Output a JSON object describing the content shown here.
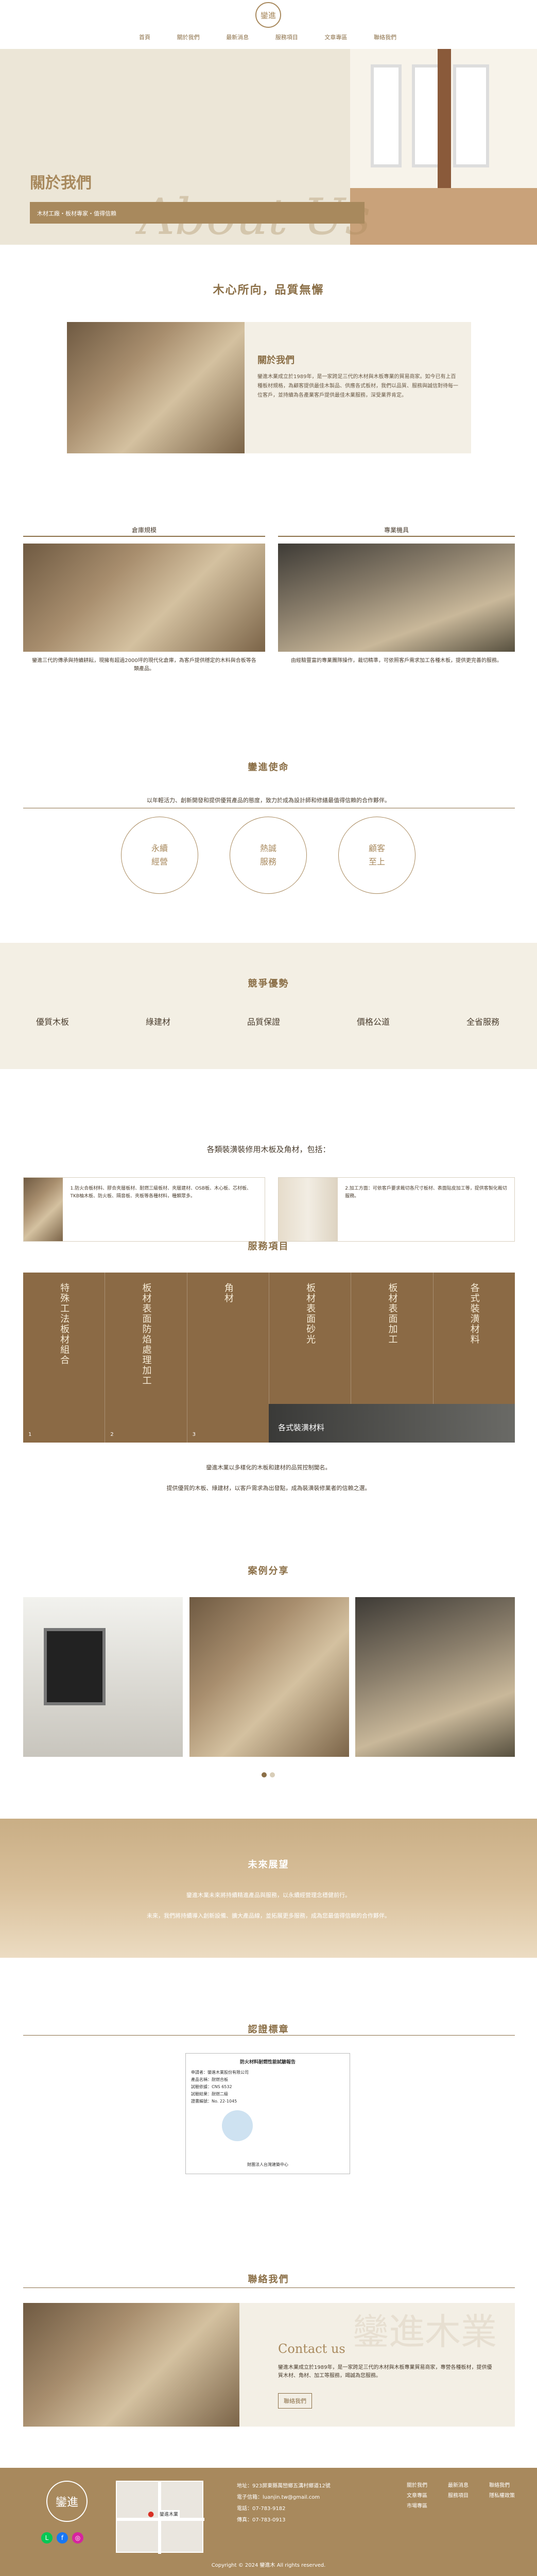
{
  "brand": {
    "name": "鑾進"
  },
  "nav": {
    "items": [
      "首頁",
      "關於我們",
      "最新消息",
      "服務項目",
      "文章專區",
      "聯絡我們"
    ]
  },
  "hero": {
    "script": "About Us",
    "title": "關於我們",
    "subtitle": "木材工廠・板材專家・值得信賴"
  },
  "intro": {
    "title": "木心所向，品質無懈",
    "card_title": "關於我們",
    "card_text": "鑾進木業成立於1989年，是一家跨足三代的木材與木板專業的貿易商家。如今已有上百種板材規格，為顧客提供最佳木製品、供應各式板材，我們以品質、服務與誠信對待每一位客戶，並持續為各產業客戶提供最佳木業服務，深受業界肯定。"
  },
  "factory": {
    "left_title": "倉庫規模",
    "left_text": "鑾進三代的傳承與持續耕耘，現擁有超過2000坪的現代化倉庫，為客戶提供穩定的木料與合板等各類產品。",
    "right_title": "專業機具",
    "right_text": "由經驗豐富的專業團隊操作，裁切精準，可依照客戶需求加工各種木板，提供更完善的服務。"
  },
  "mission": {
    "title": "鑾進使命",
    "text": "以年輕活力、創新開發和提供優質產品的態度，致力於成為設計師和修繕最值得信賴的合作夥伴。",
    "circles": [
      [
        "永續",
        "經營"
      ],
      [
        "熱誠",
        "服務"
      ],
      [
        "顧客",
        "至上"
      ]
    ]
  },
  "advantage": {
    "title": "競爭優勢",
    "items": [
      "優質木板",
      "綠建材",
      "品質保證",
      "價格公道",
      "全省服務"
    ]
  },
  "products": {
    "title": "各類裝潢裝修用木板及角材，包括：",
    "left": "1.防火合板材料、膠合夾層板材、耐燃三級板材、夾層建材、OSB板、木心板、芯材板、TKB柚木板、防火板、隔音板、夾板等各種材料，種類眾多。",
    "right": "2.加工方面：可依客戶要求裁切各尺寸板材、表面貼皮加工等，提供客製化裁切服務。"
  },
  "services": {
    "title": "服務項目",
    "cols": [
      {
        "label": "特殊工法板材組合",
        "num": "1"
      },
      {
        "label": "板材表面防焰處理加工",
        "num": "2"
      },
      {
        "label": "角材",
        "num": "3"
      },
      {
        "label": "板材表面砂光",
        "num": "4"
      },
      {
        "label": "板材表面加工",
        "num": "5"
      },
      {
        "label": "各式裝潢材料",
        "num": "6"
      }
    ],
    "caption": "各式裝潢材料",
    "desc1": "鑾進木業以多樣化的木板和建材的品質控制聞名。",
    "desc2": "提供優質的木板、綠建材，以客戶需求為出發點，成為裝潢裝修業者的信賴之選。"
  },
  "cases": {
    "title": "案例分享"
  },
  "future": {
    "title": "未來展望",
    "line1": "鑾進木業未來將持續精進產品與服務，以永續經營理念穩健前行。",
    "line2": "未來，我們將持續導入創新設備、擴大產品線，並拓展更多服務，成為您最值得信賴的合作夥伴。"
  },
  "cert": {
    "title": "認證標章",
    "doc_title": "防火材料耐燃性能試驗報告",
    "doc_lines": [
      "申請者：鑾進木業股份有限公司",
      "產品名稱：耐燃合板",
      "試驗依據：CNS 6532",
      "試驗結果：耐燃二級",
      "證書編號：No. 22-1045"
    ],
    "doc_footer": "財團法人台灣建築中心"
  },
  "contact": {
    "title": "聯絡我們",
    "script": "Contact us",
    "text": "鑾進木業成立於1989年，是一家跨足三代的木材與木板專業貿易商家，專營各種板材，提供優質木材、角材、加工等服務，竭誠為您服務。",
    "button": "聯絡我們",
    "watermark": "鑾進木業"
  },
  "footer": {
    "address": "地址：923屏東縣萬巒鄉五溝村鄉道12號",
    "email": "電子信箱：luanjin.tw@gmail.com",
    "phone": "電話：07-783-9182",
    "fax": "傳真：07-783-0913",
    "map_label": "鑾進木業",
    "links": [
      [
        "關於我們",
        "最新消息",
        "聯絡我們"
      ],
      [
        "文章專區",
        "服務項目",
        "隱私權政策"
      ],
      [
        "市場專區"
      ]
    ],
    "copyright": "Copyright © 2024 鑾進木 All rights reserved."
  },
  "colors": {
    "accent": "#a8895d",
    "dark": "#8b6f47",
    "bg": "#ece6d7"
  }
}
